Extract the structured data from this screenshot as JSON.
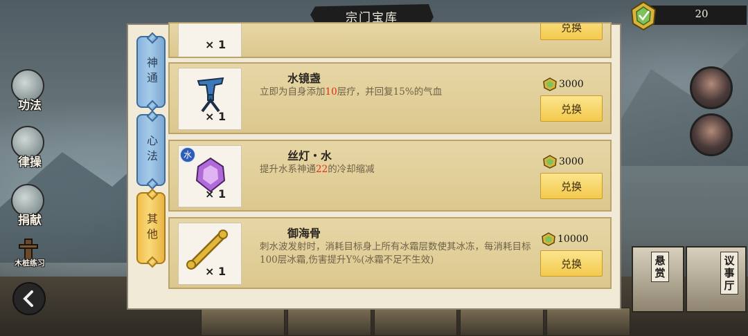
{
  "header": {
    "title": "宗门宝库"
  },
  "currency": {
    "amount": "20",
    "icon": "gem-token-icon"
  },
  "left_nav": [
    {
      "label": "功法",
      "icon": "scroll-icon"
    },
    {
      "label": "律操",
      "icon": "hand-icon"
    },
    {
      "label": "捐献",
      "icon": "bird-icon"
    },
    {
      "label": "木桩练习",
      "icon": "training-dummy-icon"
    }
  ],
  "tabs": [
    {
      "label": "神通",
      "active": false
    },
    {
      "label": "心法",
      "active": false
    },
    {
      "label": "其他",
      "active": true
    }
  ],
  "partial_item": {
    "qty": "× 1",
    "button": "兑换"
  },
  "items": [
    {
      "name": "水镜盏",
      "desc_parts": [
        "立即为自身添加",
        "10",
        "层疗，并回复15%的气血"
      ],
      "qty": "× 1",
      "price": "3000",
      "button": "兑换",
      "icon": "blue-goblet-icon"
    },
    {
      "name": "丝灯・水",
      "desc_parts": [
        "提升水系神通",
        "22",
        "的冷却缩减"
      ],
      "badge": "水",
      "qty": "× 1",
      "price": "3000",
      "button": "兑换",
      "icon": "purple-lantern-icon"
    },
    {
      "name": "御海骨",
      "desc_parts": [
        "刺水波发射时，消耗目标身上所有冰霜层数使其冰冻，每消耗目标100层冰霜,伤害提升Y%(冰霜不足不生效)"
      ],
      "qty": "× 1",
      "price": "10000",
      "button": "兑换",
      "icon": "golden-bone-icon"
    }
  ],
  "right_buildings": [
    {
      "label": "悬赏"
    },
    {
      "label": "议事厅"
    }
  ],
  "colors": {
    "row_bg": "#e2d09a",
    "button_gold": "#f4c94d",
    "tab_blue": "#9cc4e6",
    "tab_gold": "#f4c54f",
    "highlight_red": "#e32b17"
  }
}
